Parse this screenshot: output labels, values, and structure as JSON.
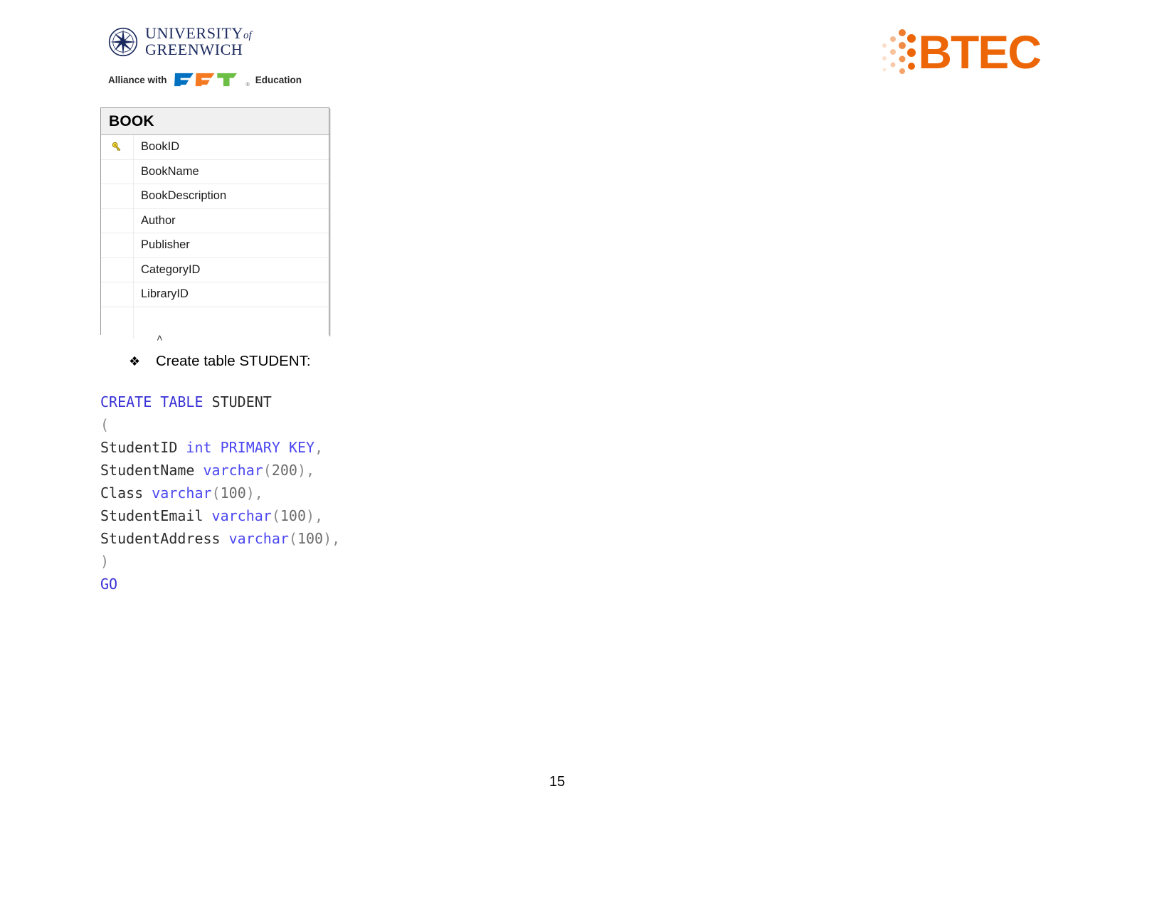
{
  "header": {
    "university": {
      "logo_icon": "compass-rose-icon",
      "line1": "UNIVERSITY",
      "line1_suffix": "of",
      "line2": "GREENWICH"
    },
    "alliance": {
      "prefix": "Alliance with",
      "partner_logo_icon": "fpt-logo-icon",
      "partner_name": "FPT",
      "registered_mark": "®",
      "suffix": "Education"
    },
    "btec": {
      "dots_icon": "btec-dots-icon",
      "wordmark": "BTEC",
      "color": "#ec6608"
    }
  },
  "er_diagram": {
    "table_name": "BOOK",
    "primary_key_icon": "key-icon",
    "resize_marker": "˄",
    "columns": [
      {
        "name": "BookID",
        "is_primary_key": true
      },
      {
        "name": "BookName",
        "is_primary_key": false
      },
      {
        "name": "BookDescription",
        "is_primary_key": false
      },
      {
        "name": "Author",
        "is_primary_key": false
      },
      {
        "name": "Publisher",
        "is_primary_key": false
      },
      {
        "name": "CategoryID",
        "is_primary_key": false
      },
      {
        "name": "LibraryID",
        "is_primary_key": false
      }
    ]
  },
  "bullet": {
    "glyph": "❖",
    "text": "Create table STUDENT:"
  },
  "code": {
    "language": "sql",
    "lines": [
      {
        "tokens": [
          {
            "t": "CREATE",
            "c": "kw"
          },
          {
            "t": " ",
            "c": "idn"
          },
          {
            "t": "TABLE",
            "c": "kw"
          },
          {
            "t": " ",
            "c": "idn"
          },
          {
            "t": "STUDENT",
            "c": "idn"
          }
        ]
      },
      {
        "tokens": [
          {
            "t": "(",
            "c": "pun"
          }
        ]
      },
      {
        "tokens": [
          {
            "t": "StudentID",
            "c": "idn"
          },
          {
            "t": " ",
            "c": "idn"
          },
          {
            "t": "int",
            "c": "typ"
          },
          {
            "t": " ",
            "c": "idn"
          },
          {
            "t": "PRIMARY",
            "c": "typ"
          },
          {
            "t": " ",
            "c": "idn"
          },
          {
            "t": "KEY",
            "c": "typ"
          },
          {
            "t": ",",
            "c": "pun"
          }
        ]
      },
      {
        "tokens": [
          {
            "t": "StudentName",
            "c": "idn"
          },
          {
            "t": " ",
            "c": "idn"
          },
          {
            "t": "varchar",
            "c": "typ"
          },
          {
            "t": "(",
            "c": "pun"
          },
          {
            "t": "200",
            "c": "num"
          },
          {
            "t": ")",
            "c": "pun"
          },
          {
            "t": ",",
            "c": "pun"
          }
        ]
      },
      {
        "tokens": [
          {
            "t": "Class",
            "c": "idn"
          },
          {
            "t": " ",
            "c": "idn"
          },
          {
            "t": "varchar",
            "c": "typ"
          },
          {
            "t": "(",
            "c": "pun"
          },
          {
            "t": "100",
            "c": "num"
          },
          {
            "t": ")",
            "c": "pun"
          },
          {
            "t": ",",
            "c": "pun"
          }
        ]
      },
      {
        "tokens": [
          {
            "t": "StudentEmail",
            "c": "idn"
          },
          {
            "t": " ",
            "c": "idn"
          },
          {
            "t": "varchar",
            "c": "typ"
          },
          {
            "t": "(",
            "c": "pun"
          },
          {
            "t": "100",
            "c": "num"
          },
          {
            "t": ")",
            "c": "pun"
          },
          {
            "t": ",",
            "c": "pun"
          }
        ]
      },
      {
        "tokens": [
          {
            "t": "StudentAddress",
            "c": "idn"
          },
          {
            "t": " ",
            "c": "idn"
          },
          {
            "t": "varchar",
            "c": "typ"
          },
          {
            "t": "(",
            "c": "pun"
          },
          {
            "t": "100",
            "c": "num"
          },
          {
            "t": ")",
            "c": "pun"
          },
          {
            "t": ",",
            "c": "pun"
          }
        ]
      },
      {
        "tokens": [
          {
            "t": ")",
            "c": "pun"
          }
        ]
      },
      {
        "tokens": [
          {
            "t": "GO",
            "c": "kw"
          }
        ]
      }
    ]
  },
  "footer": {
    "page_number": "15"
  }
}
